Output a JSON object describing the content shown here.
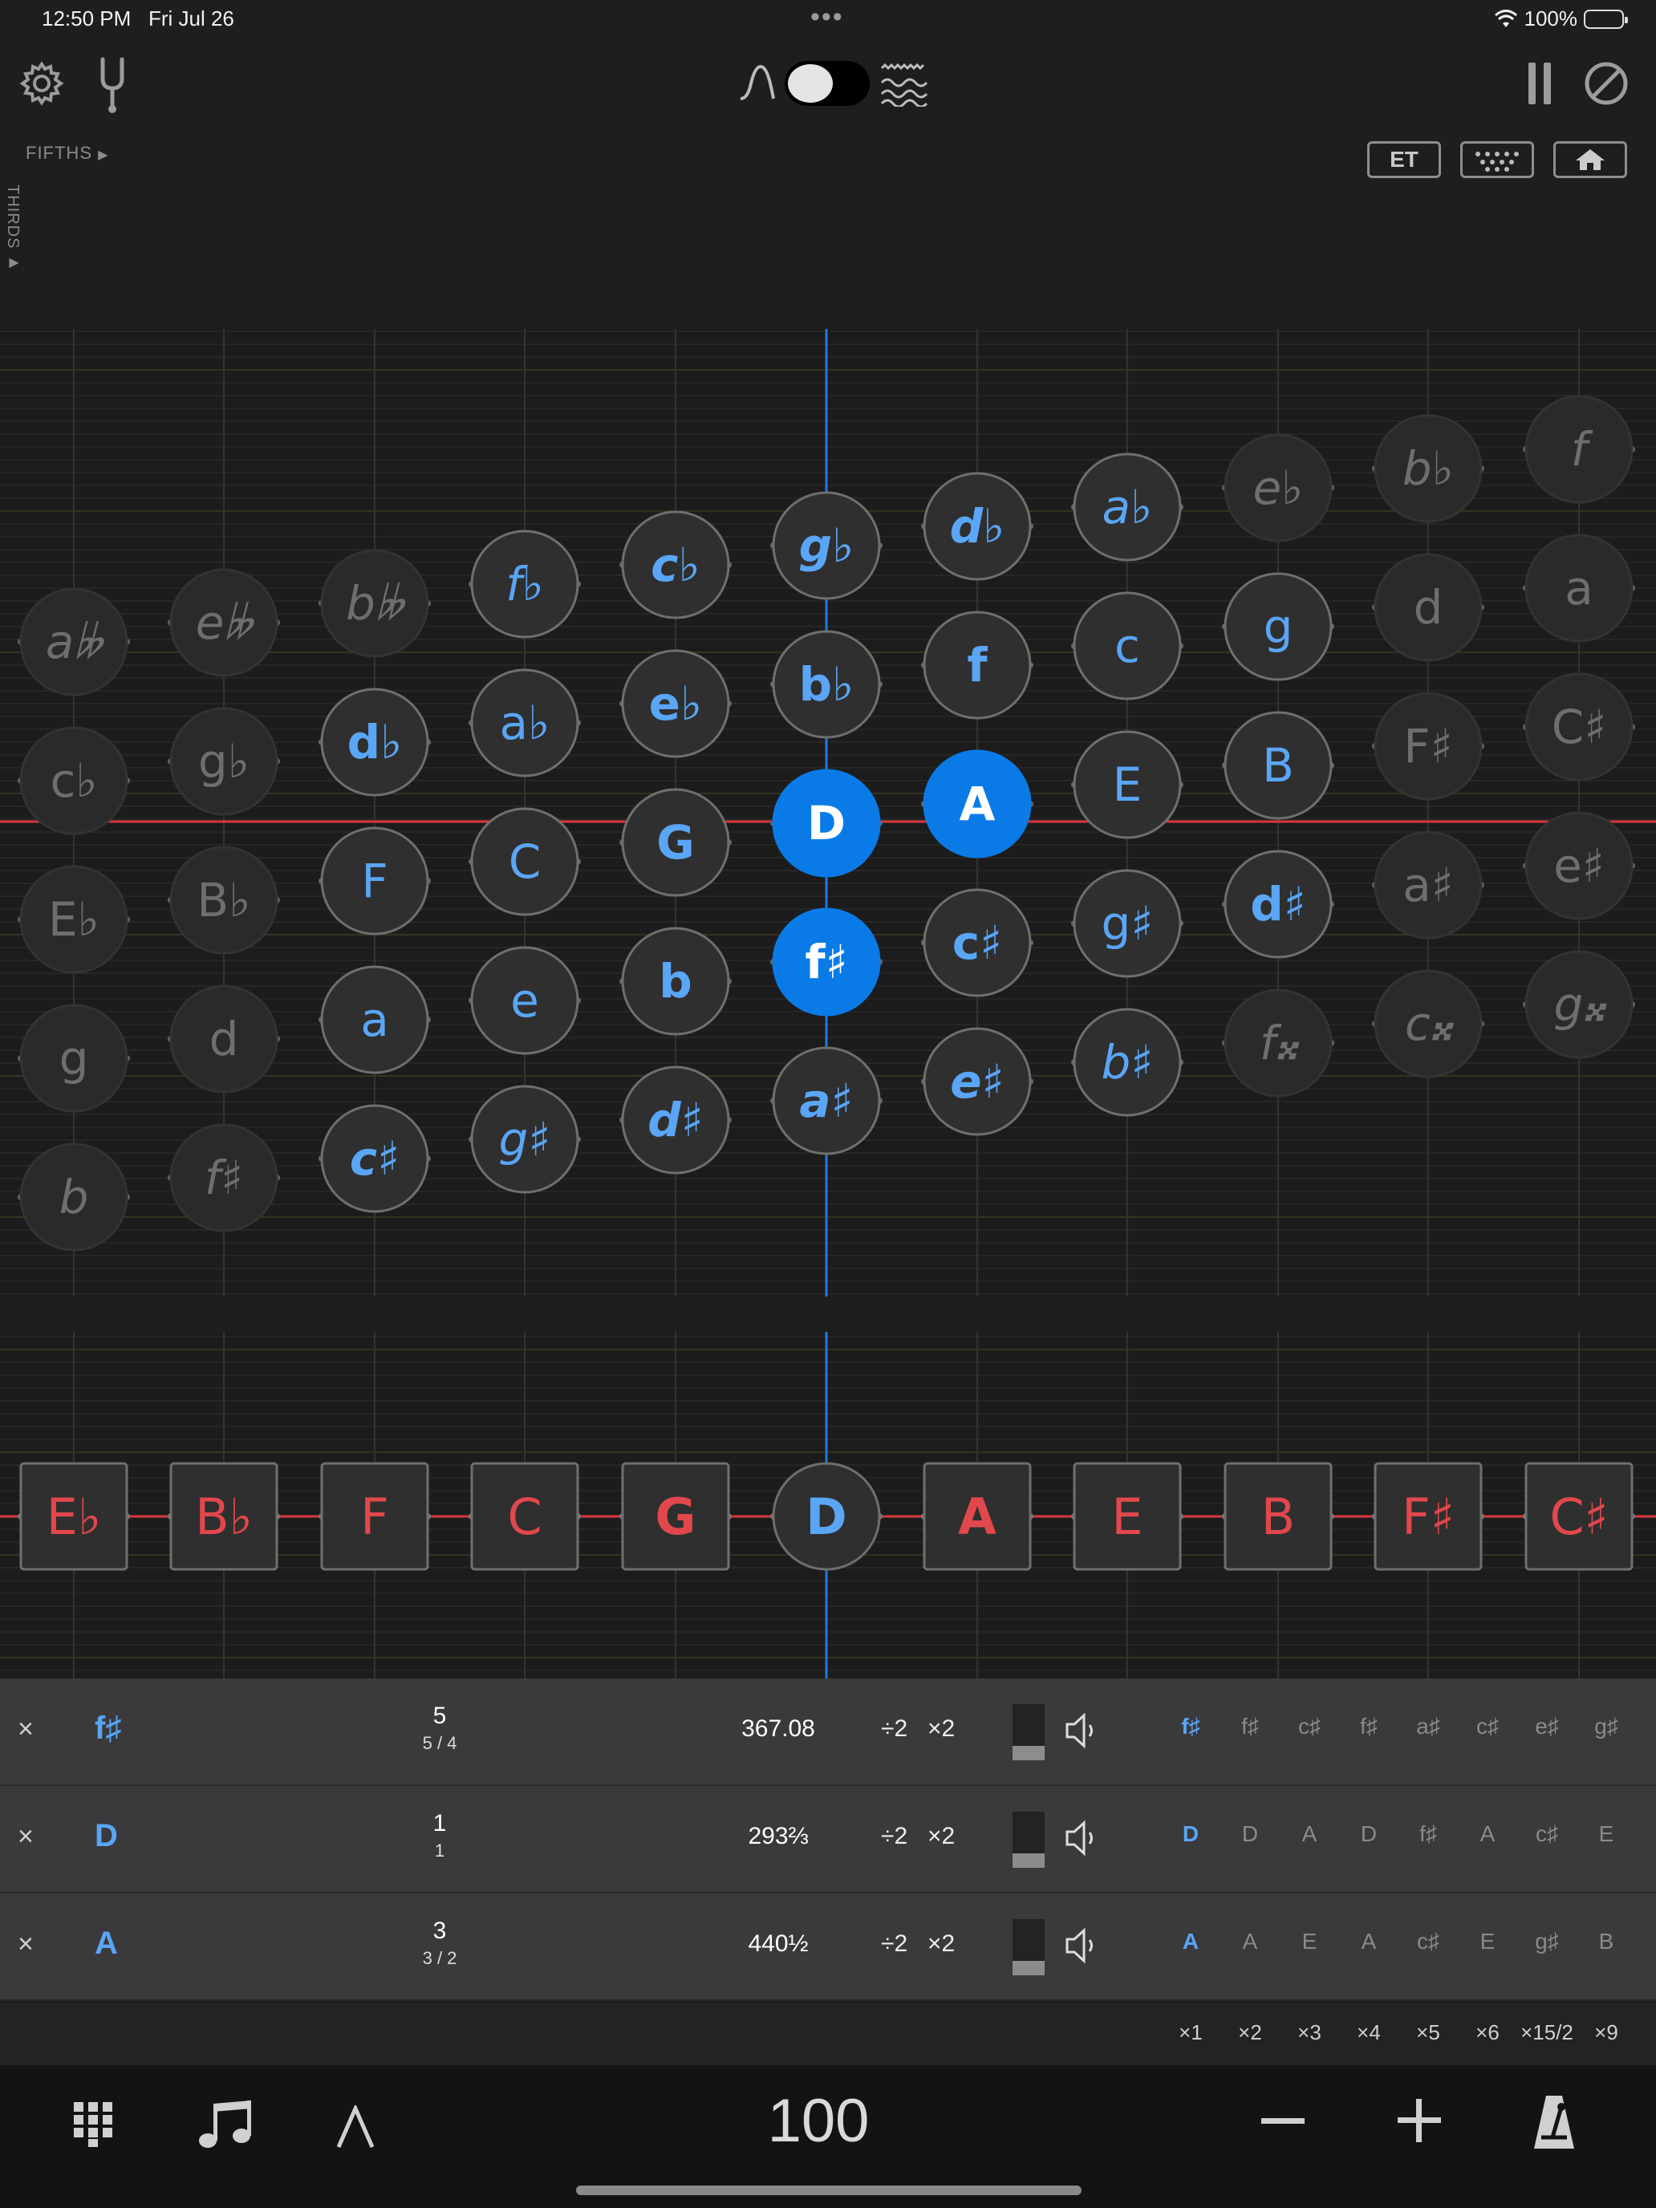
{
  "status_bar": {
    "time": "12:50 PM",
    "date": "Fri Jul 26",
    "dots": "•••",
    "battery": "100%"
  },
  "toolbar": {
    "settings_icon": "gear-icon",
    "fork_icon": "tuning-fork-icon",
    "wave_left_icon": "sine-wave-icon",
    "wave_right_icon": "complex-wave-icon",
    "pause_icon": "pause-icon",
    "clear_icon": "prohibit-icon",
    "fifths_label": "FIFTHS",
    "thirds_label": "THIRDS",
    "et_label": "ET",
    "grid_icon": "keyboard-grid-icon",
    "home_icon": "home-icon"
  },
  "lattice": {
    "columns": [
      [
        "a𝄫",
        "c♭",
        "E♭",
        "g",
        "b"
      ],
      [
        "e𝄫",
        "g♭",
        "B♭",
        "d",
        "f♯"
      ],
      [
        "b𝄫",
        "d♭",
        "F",
        "a",
        "c♯"
      ],
      [
        "f♭",
        "a♭",
        "C",
        "e",
        "g♯"
      ],
      [
        "c♭",
        "e♭",
        "G",
        "b",
        "d♯"
      ],
      [
        "g♭",
        "b♭",
        "D",
        "f♯",
        "a♯"
      ],
      [
        "d♭",
        "f",
        "A",
        "c♯",
        "e♯"
      ],
      [
        "a♭",
        "c",
        "E",
        "g♯",
        "b♯"
      ],
      [
        "e♭",
        "g",
        "B",
        "d♯",
        "f𝄪"
      ],
      [
        "b♭",
        "d",
        "F♯",
        "a♯",
        "c𝄪"
      ],
      [
        "f",
        "a",
        "C♯",
        "e♯",
        "g𝄪"
      ]
    ],
    "active": [
      "D",
      "A",
      "f♯"
    ],
    "colors": {
      "accent": "#0a7be6",
      "note_text": "#5aa5f5",
      "dim_text": "#7a7a7a",
      "red_line": "#d9373c"
    }
  },
  "strip": {
    "notes": [
      "E♭",
      "B♭",
      "F",
      "C",
      "G",
      "D",
      "A",
      "E",
      "B",
      "F♯",
      "C♯"
    ]
  },
  "rows": [
    {
      "remove": "×",
      "note": "f♯",
      "numerator": "5",
      "ratio": "5 / 4",
      "freq": "367.08",
      "div": "÷2",
      "mul": "×2",
      "harmonics": [
        "f♯",
        "f♯",
        "c♯",
        "f♯",
        "a♯",
        "c♯",
        "e♯",
        "g♯"
      ]
    },
    {
      "remove": "×",
      "note": "D",
      "numerator": "1",
      "ratio": "1",
      "freq": "293⅔",
      "div": "÷2",
      "mul": "×2",
      "harmonics": [
        "D",
        "D",
        "A",
        "D",
        "f♯",
        "A",
        "c♯",
        "E"
      ]
    },
    {
      "remove": "×",
      "note": "A",
      "numerator": "3",
      "ratio": "3 / 2",
      "freq": "440½",
      "div": "÷2",
      "mul": "×2",
      "harmonics": [
        "A",
        "A",
        "E",
        "A",
        "c♯",
        "E",
        "g♯",
        "B"
      ]
    }
  ],
  "multipliers": [
    "×1",
    "×2",
    "×3",
    "×4",
    "×5",
    "×6",
    "×15/2",
    "×9"
  ],
  "bottom_bar": {
    "keyboard_icon": "keypad-icon",
    "notes_icon": "music-notes-icon",
    "wedge_icon": "wedge-icon",
    "tempo": "100",
    "minus_icon": "minus-icon",
    "plus_icon": "plus-icon",
    "metronome_icon": "metronome-icon"
  }
}
